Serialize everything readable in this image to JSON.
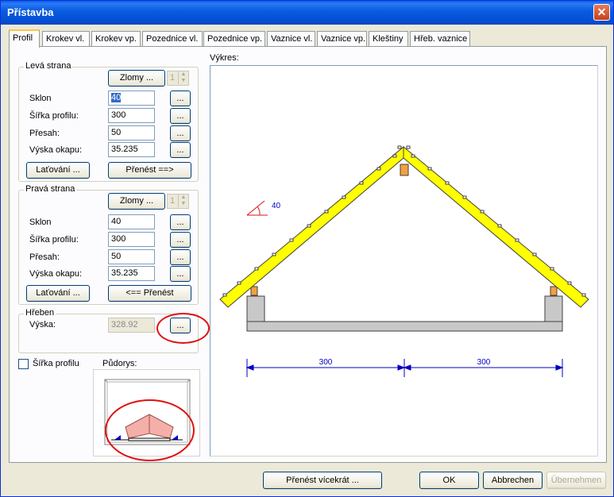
{
  "window": {
    "title": "Přístavba",
    "close_glyph": "✕"
  },
  "tabs": [
    {
      "label": "Profil",
      "active": true
    },
    {
      "label": "Krokev vl."
    },
    {
      "label": "Krokev vp."
    },
    {
      "label": "Pozednice vl."
    },
    {
      "label": "Pozednice vp."
    },
    {
      "label": "Vaznice vl."
    },
    {
      "label": "Vaznice vp."
    },
    {
      "label": "Kleštiny"
    },
    {
      "label": "Hřeb. vaznice"
    }
  ],
  "left_side": {
    "title": "Levá strana",
    "zlomy_button": "Zlomy ...",
    "zlomy_value": "1",
    "fields": [
      {
        "label": "Sklon",
        "value": "40",
        "button": "..."
      },
      {
        "label": "Šířka profilu:",
        "value": "300",
        "button": "..."
      },
      {
        "label": "Přesah:",
        "value": "50",
        "button": "..."
      },
      {
        "label": "Výska okapu:",
        "value": "35.235",
        "button": "..."
      }
    ],
    "latovani_button": "Laťování ...",
    "transfer_button": "Přenést ==>"
  },
  "right_side": {
    "title": "Pravá strana",
    "zlomy_button": "Zlomy ...",
    "zlomy_value": "1",
    "fields": [
      {
        "label": "Sklon",
        "value": "40",
        "button": "..."
      },
      {
        "label": "Šířka profilu:",
        "value": "300",
        "button": "..."
      },
      {
        "label": "Přesah:",
        "value": "50",
        "button": "..."
      },
      {
        "label": "Výska okapu:",
        "value": "35.235",
        "button": "..."
      }
    ],
    "latovani_button": "Laťování ...",
    "transfer_button": "<== Přenést"
  },
  "ridge": {
    "title": "Hřeben",
    "height_label": "Výska:",
    "height_value": "328.92",
    "button": "..."
  },
  "profile_width_checkbox": {
    "label": "Šířka profilu",
    "checked": false
  },
  "plan_label": "Půdorys:",
  "drawing_label": "Výkres:",
  "drawing": {
    "angle_label": "40",
    "dimensions": [
      "300",
      "300"
    ],
    "rafter_color": "#ffff00",
    "dimension_color": "#0000c0",
    "plan_roof_color": "#f4b0a8",
    "plan_arrow_color": "#0000e0",
    "annotation_color": "#e01010"
  },
  "footer": {
    "transfer_multi": "Přenést vícekrát ...",
    "ok": "OK",
    "cancel": "Abbrechen",
    "apply": "Übernehmen"
  }
}
